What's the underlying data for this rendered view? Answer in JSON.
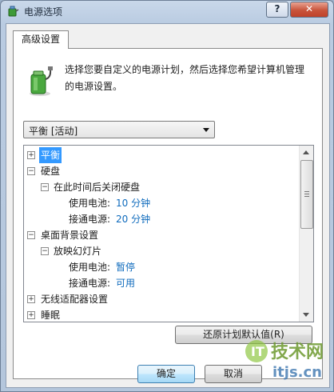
{
  "window": {
    "title": "电源选项",
    "help": "?",
    "close": "✕"
  },
  "tab": {
    "label": "高级设置"
  },
  "description": "选择您要自定义的电源计划，然后选择您希望计算机管理的电源设置。",
  "plan_select": {
    "value": "平衡 [活动]"
  },
  "tree": {
    "items": [
      {
        "label": "平衡",
        "expander": "+"
      },
      {
        "label": "硬盘",
        "expander": "−"
      },
      {
        "label": "在此时间后关闭硬盘",
        "expander": "−"
      },
      {
        "label": "使用电池:",
        "value": "10 分钟"
      },
      {
        "label": "接通电源:",
        "value": "20 分钟"
      },
      {
        "label": "桌面背景设置",
        "expander": "−"
      },
      {
        "label": "放映幻灯片",
        "expander": "−"
      },
      {
        "label": "使用电池:",
        "value": "暂停"
      },
      {
        "label": "接通电源:",
        "value": "可用"
      },
      {
        "label": "无线适配器设置",
        "expander": "+"
      },
      {
        "label": "睡眠",
        "expander": "+"
      }
    ]
  },
  "buttons": {
    "restore": "还原计划默认值(R)",
    "ok": "确定",
    "cancel": "取消"
  },
  "watermark": {
    "brand": "技术网",
    "site": "itjs.cn"
  },
  "colors": {
    "value_link": "#0f6bbd",
    "selection": "#3399ff"
  }
}
